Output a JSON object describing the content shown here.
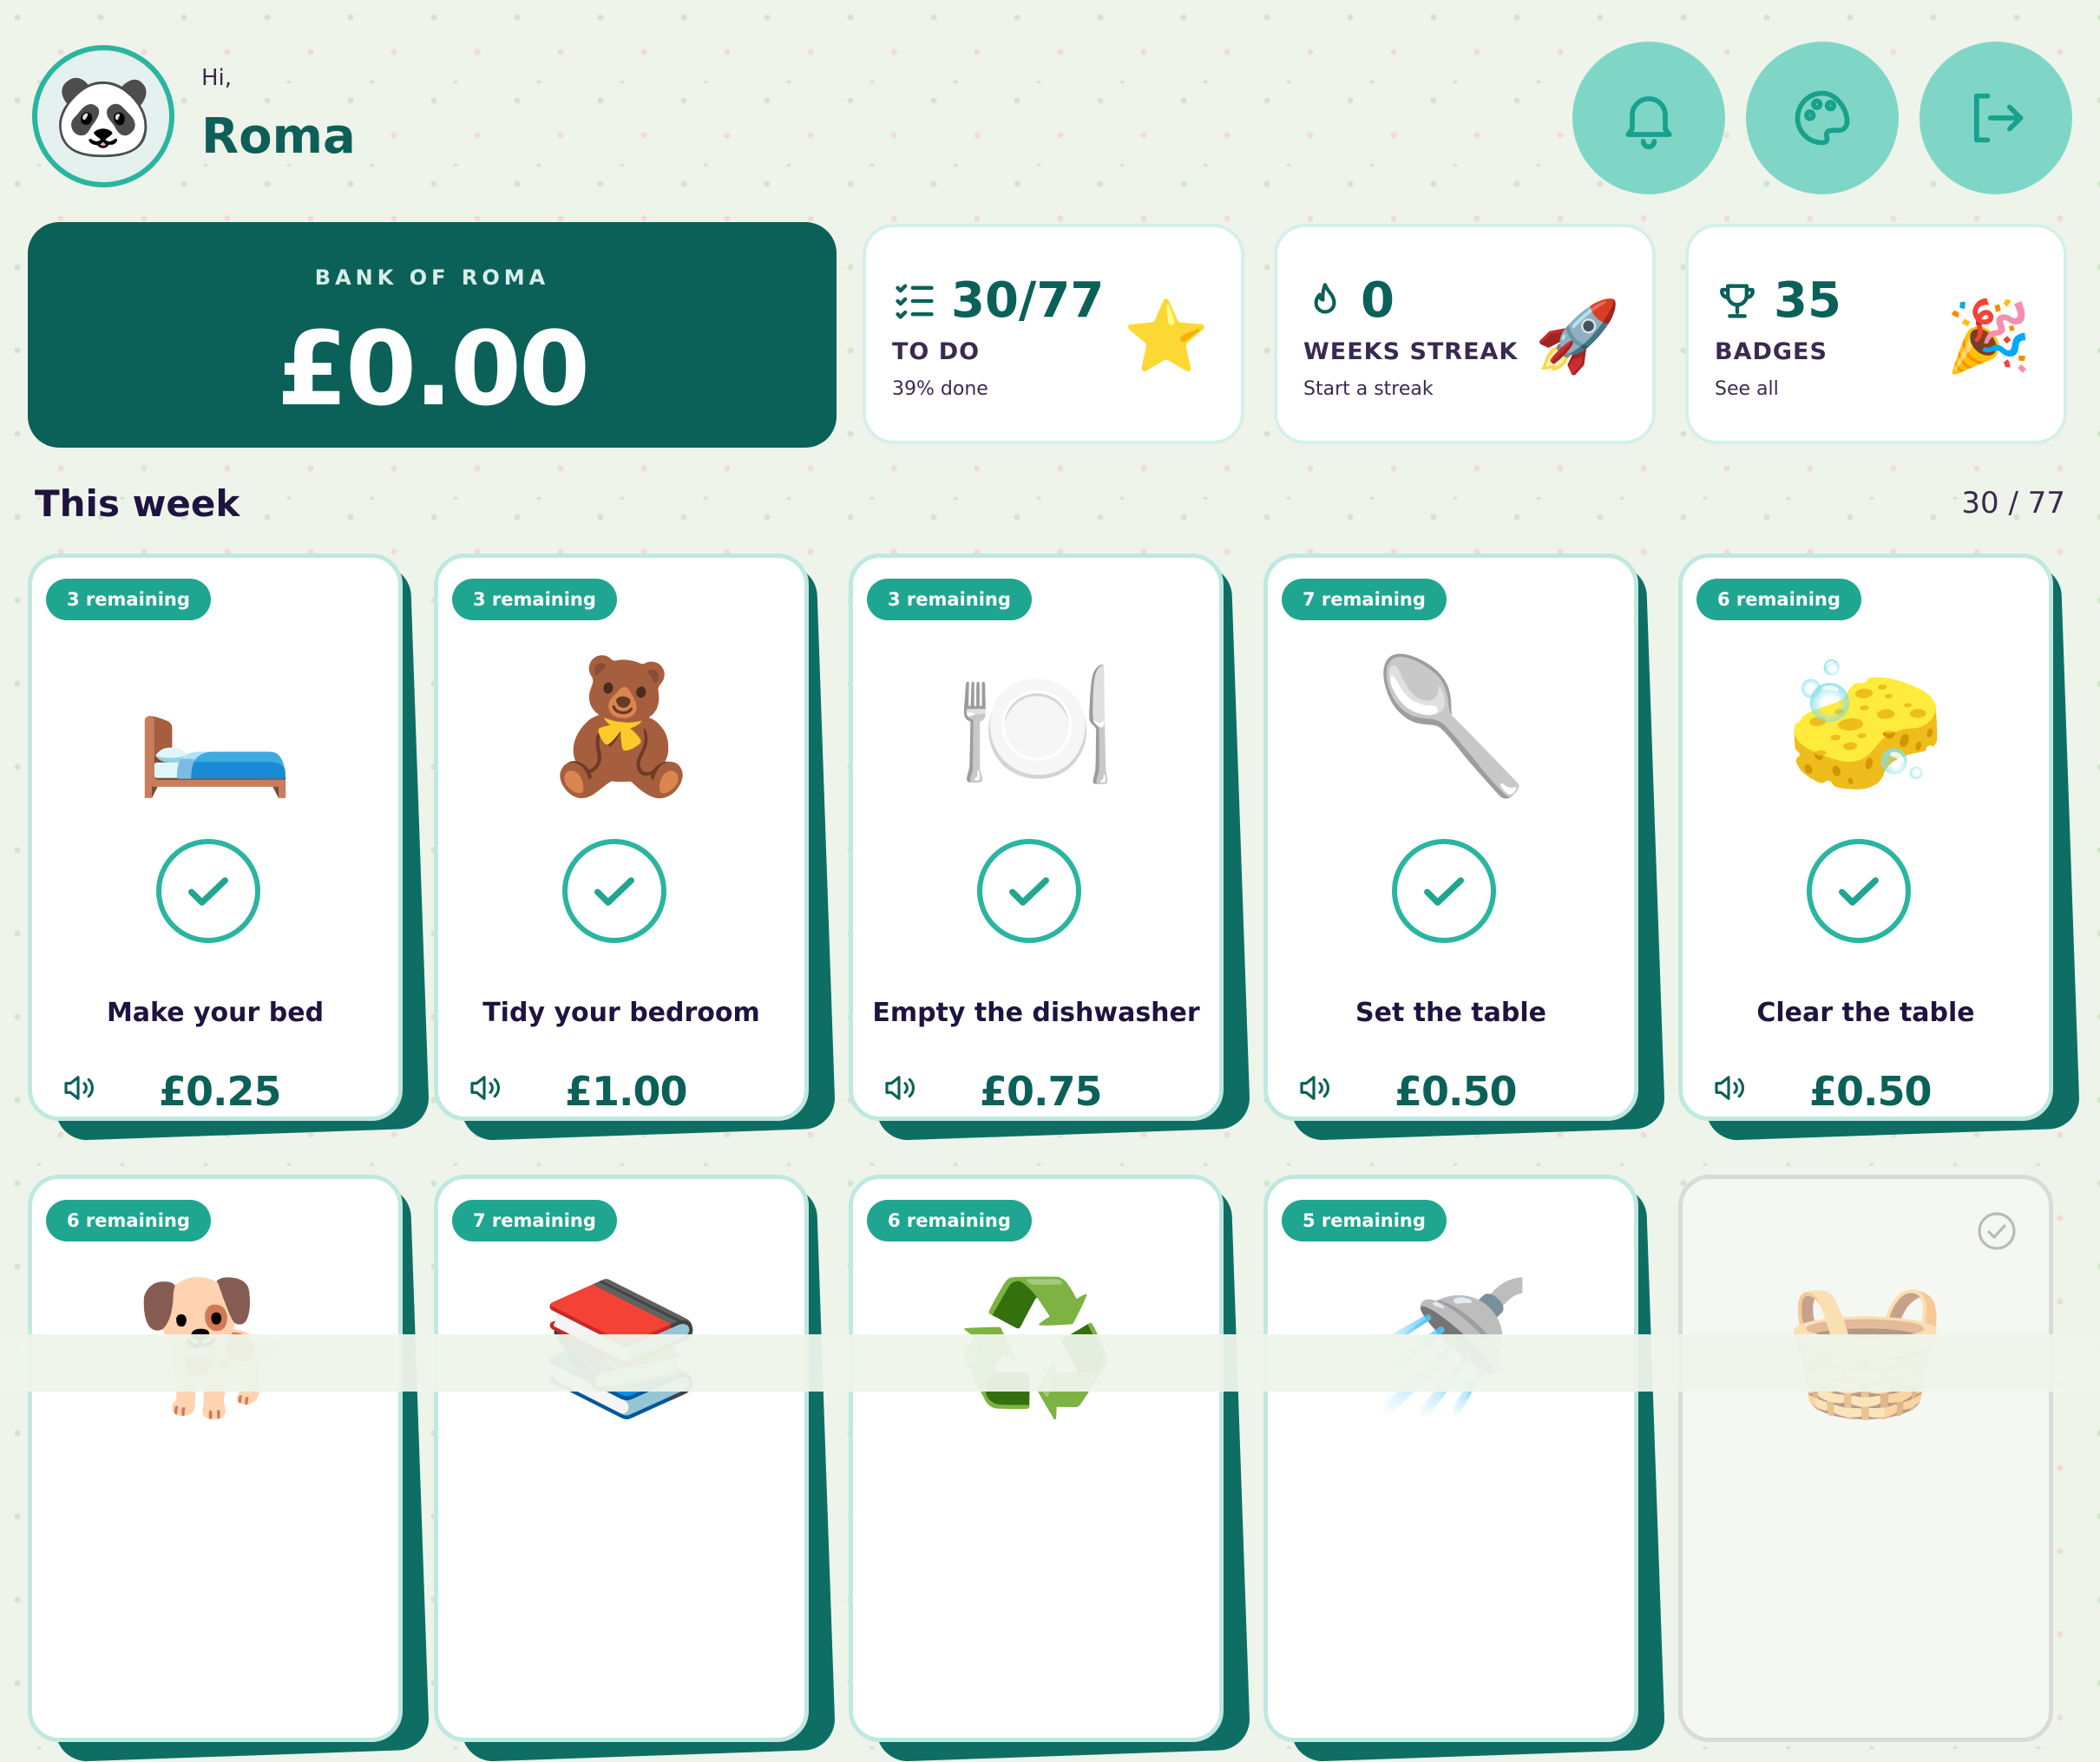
{
  "header": {
    "greeting": "Hi,",
    "name": "Roma",
    "avatar_emoji": "🐼",
    "buttons": [
      {
        "name": "notifications-button",
        "icon": "bell-icon"
      },
      {
        "name": "theme-button",
        "icon": "palette-icon"
      },
      {
        "name": "logout-button",
        "icon": "logout-icon"
      }
    ]
  },
  "bank": {
    "label": "BANK OF ROMA",
    "amount": "£0.00"
  },
  "stats": {
    "todo": {
      "value": "30/77",
      "label": "TO DO",
      "sub": "39% done",
      "emoji": "⭐"
    },
    "streak": {
      "value": "0",
      "label": "WEEKS STREAK",
      "sub": "Start a streak",
      "emoji": "🚀"
    },
    "badges": {
      "value": "35",
      "label": "BADGES",
      "sub": "See all",
      "emoji": "🎉"
    }
  },
  "week": {
    "title": "This week",
    "count": "30 / 77"
  },
  "chores": [
    {
      "remaining": "3 remaining",
      "emoji": "🛏️",
      "name": "Make your bed",
      "price": "£0.25"
    },
    {
      "remaining": "3 remaining",
      "emoji": "🧸",
      "name": "Tidy your bedroom",
      "price": "£1.00"
    },
    {
      "remaining": "3 remaining",
      "emoji": "🍽️",
      "name": "Empty the dishwasher",
      "price": "£0.75"
    },
    {
      "remaining": "7 remaining",
      "emoji": "🥄",
      "name": "Set the table",
      "price": "£0.50"
    },
    {
      "remaining": "6 remaining",
      "emoji": "🧽",
      "name": "Clear the table",
      "price": "£0.50"
    },
    {
      "remaining": "6 remaining",
      "emoji": "🐕"
    },
    {
      "remaining": "7 remaining",
      "emoji": "📚"
    },
    {
      "remaining": "6 remaining",
      "emoji": "♻️"
    },
    {
      "remaining": "5 remaining",
      "emoji": "🚿"
    },
    {
      "emoji": "🧺"
    }
  ],
  "colors": {
    "primary": "#0b6158",
    "accent": "#2ab5a0",
    "pill": "#1fa690",
    "text": "#1f1440"
  }
}
